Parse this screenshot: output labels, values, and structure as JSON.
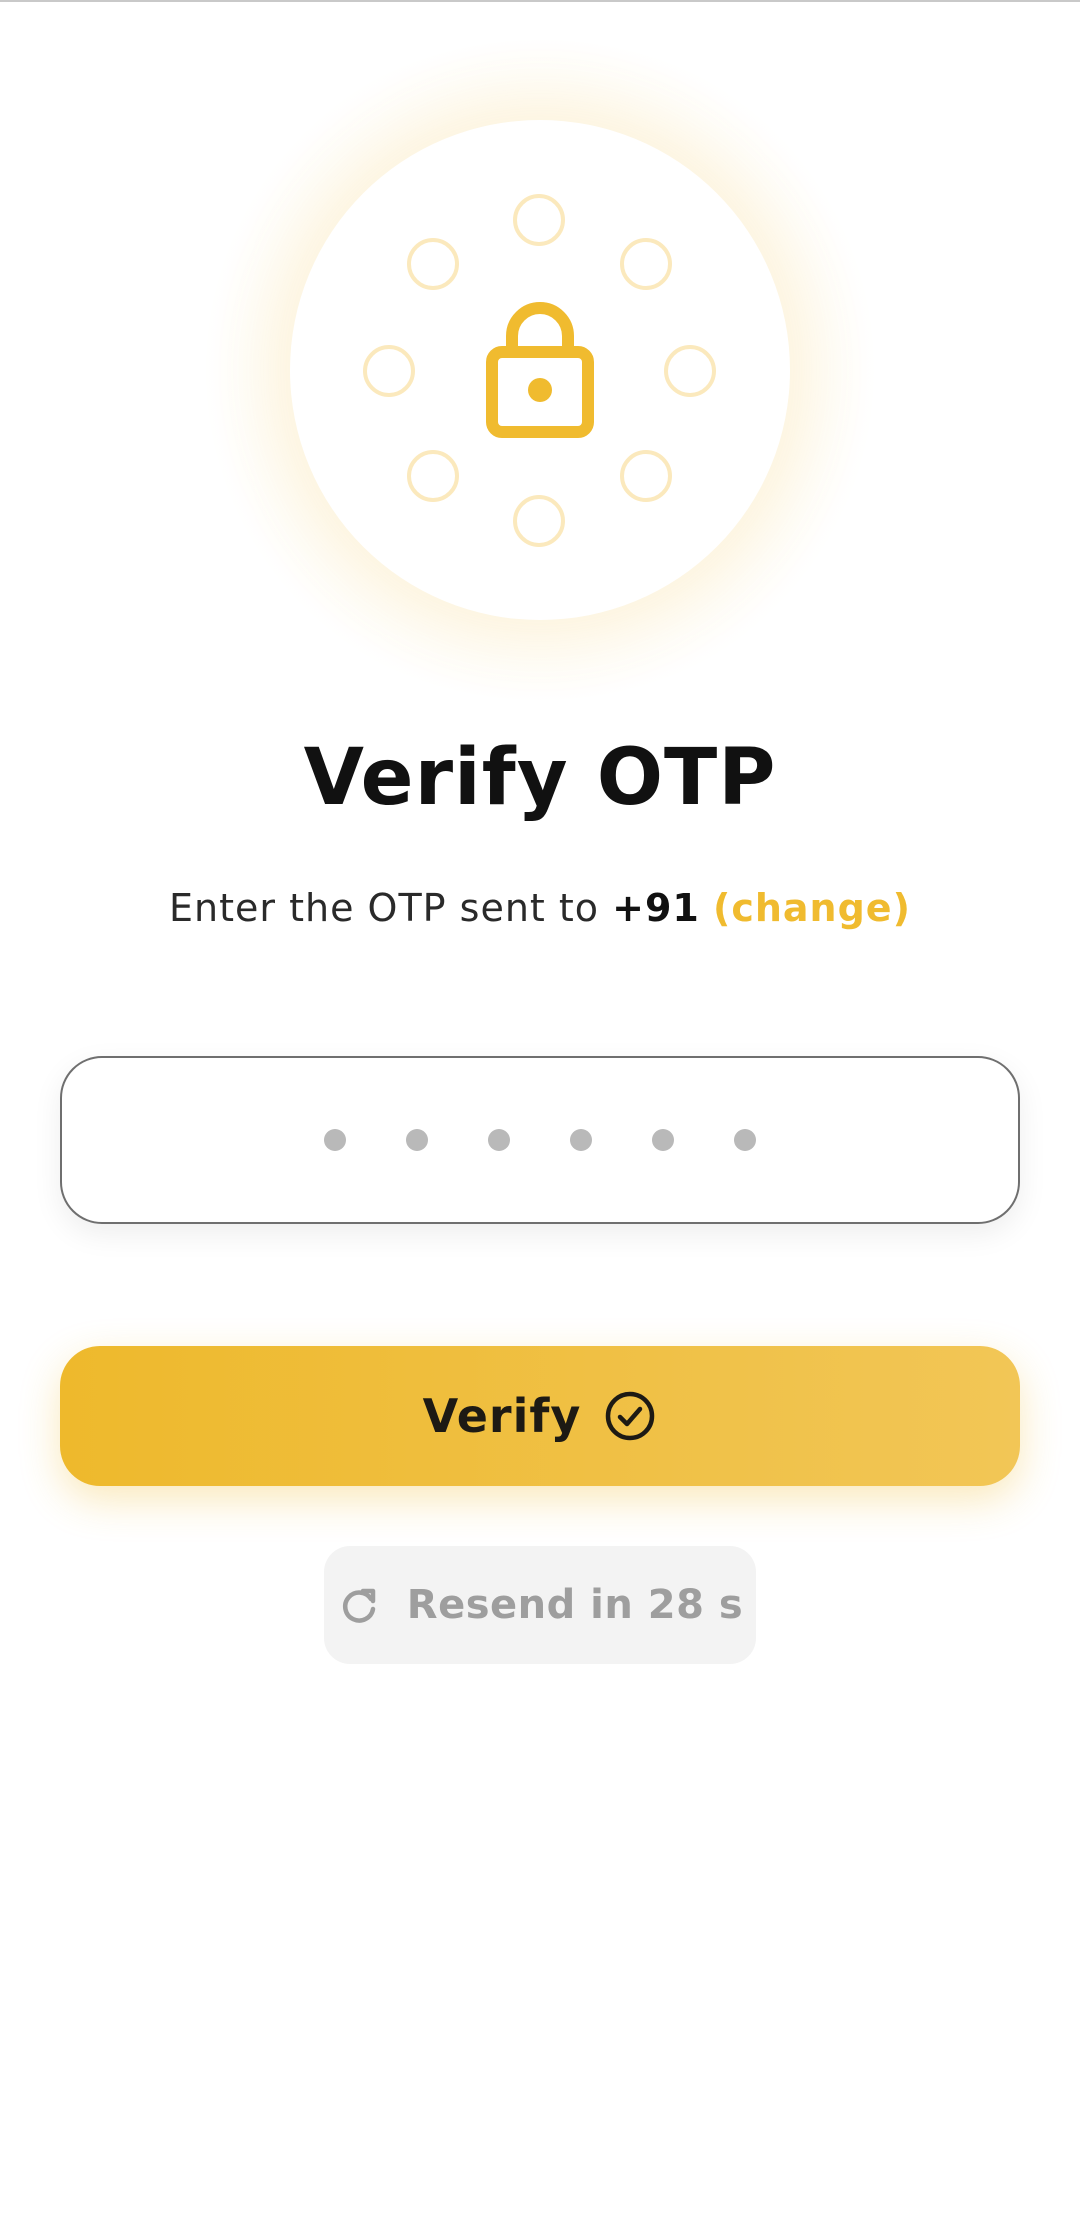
{
  "screen": {
    "title": "Verify OTP",
    "subtitle": {
      "prefix": "Enter the OTP sent to ",
      "phone": "+91",
      "change_link": "(change)"
    }
  },
  "otp_input": {
    "digits_count": 6,
    "value": ""
  },
  "verify_button": {
    "label": "Verify",
    "icon": "check-circle-icon"
  },
  "resend_button": {
    "label": "Resend in 28 s",
    "icon": "refresh-icon",
    "enabled": false
  },
  "illustration": {
    "icon": "lock-icon"
  },
  "colors": {
    "accent": "#F0BB2F",
    "accent_light": "#FBE9BD",
    "text_primary": "#111111",
    "text_muted": "#9E9E9E",
    "input_border": "#6F6F6F",
    "resend_bg": "#F3F3F3"
  }
}
